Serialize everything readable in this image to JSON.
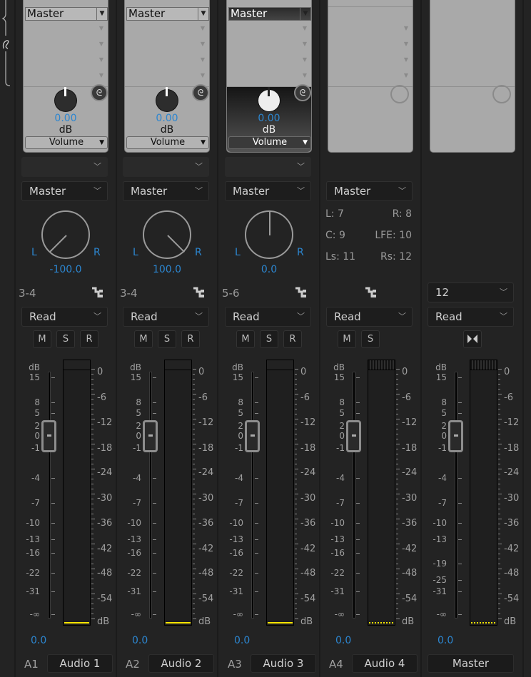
{
  "meter_scale": [
    "0",
    "-6",
    "-12",
    "-18",
    "-24",
    "-30",
    "-36",
    "-42",
    "-48",
    "-54",
    "dB"
  ],
  "colors": {
    "value_blue": "#2c86d0",
    "meter_peak": "#ffe600",
    "background": "#232323"
  },
  "tracks": [
    {
      "id": "A1",
      "name": "Audio 1",
      "fx_insert": "Master",
      "fx_value": "0.00",
      "fx_unit": "dB",
      "fx_param": "Volume",
      "send_output": "Master",
      "pan_value": "-100.0",
      "pan_l": "L",
      "pan_r": "R",
      "channels": "3-4",
      "automation": "Read",
      "buttons": [
        "M",
        "S",
        "R"
      ],
      "fader_value": "0.0",
      "fader_scale": [
        "dB",
        "15",
        "8",
        "5",
        "2",
        "0",
        "-1",
        "-4",
        "-7",
        "-10",
        "-13",
        "-16",
        "-22",
        "-31",
        "-∞"
      ],
      "pan": -100
    },
    {
      "id": "A2",
      "name": "Audio 2",
      "fx_insert": "Master",
      "fx_value": "0.00",
      "fx_unit": "dB",
      "fx_param": "Volume",
      "send_output": "Master",
      "pan_value": "100.0",
      "pan_l": "L",
      "pan_r": "R",
      "channels": "3-4",
      "automation": "Read",
      "buttons": [
        "M",
        "S",
        "R"
      ],
      "fader_value": "0.0",
      "fader_scale": [
        "dB",
        "15",
        "8",
        "5",
        "2",
        "0",
        "-1",
        "-4",
        "-7",
        "-10",
        "-13",
        "-16",
        "-22",
        "-31",
        "-∞"
      ],
      "pan": 100
    },
    {
      "id": "A3",
      "name": "Audio 3",
      "fx_insert": "Master",
      "fx_value": "0.00",
      "fx_unit": "dB",
      "fx_param": "Volume",
      "send_output": "Master",
      "pan_value": "0.0",
      "pan_l": "L",
      "pan_r": "R",
      "channels": "5-6",
      "automation": "Read",
      "buttons": [
        "M",
        "S",
        "R"
      ],
      "fader_value": "0.0",
      "fader_scale": [
        "dB",
        "15",
        "8",
        "5",
        "2",
        "0",
        "-1",
        "-4",
        "-7",
        "-10",
        "-13",
        "-16",
        "-22",
        "-31",
        "-∞"
      ],
      "pan": 0,
      "selected": true
    },
    {
      "id": "A4",
      "name": "Audio 4",
      "send_output": "Master",
      "surround": {
        "l": "L: 7",
        "r": "R: 8",
        "c": "C: 9",
        "lfe": "LFE: 10",
        "ls": "Ls: 11",
        "rs": "Rs: 12"
      },
      "automation": "Read",
      "buttons": [
        "M",
        "S"
      ],
      "fader_value": "0.0",
      "fader_scale": [
        "dB",
        "15",
        "8",
        "5",
        "2",
        "0",
        "-1",
        "-4",
        "-7",
        "-10",
        "-13",
        "-16",
        "-22",
        "-31",
        "-∞"
      ]
    },
    {
      "name": "Master",
      "output_channels": "12",
      "automation": "Read",
      "fader_value": "0.0",
      "fader_scale": [
        "dB",
        "15",
        "8",
        "5",
        "2",
        "0",
        "-1",
        "-4",
        "-7",
        "-10",
        "-13",
        "-19",
        "-25",
        "-31",
        "-∞"
      ]
    }
  ]
}
